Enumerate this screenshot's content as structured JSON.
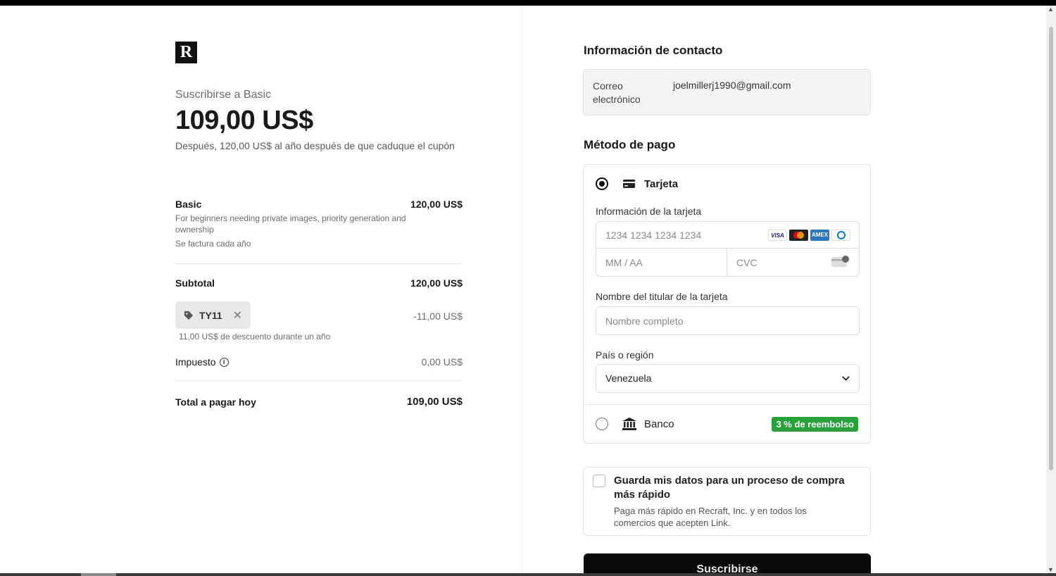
{
  "summary": {
    "logo_letter": "R",
    "subscribe_to": "Suscribirse a Basic",
    "price": "109,00 US$",
    "after_note": "Después, 120,00 US$ al año después de que caduque el cupón",
    "item": {
      "name": "Basic",
      "price": "120,00 US$",
      "description": "For beginners needing private images, priority generation and ownership",
      "billing": "Se factura cada año"
    },
    "subtotal_label": "Subtotal",
    "subtotal_value": "120,00 US$",
    "coupon_code": "TY11",
    "coupon_remove": "✕",
    "discount_value": "-11,00 US$",
    "discount_note": "11,00 US$ de descuento durante un año",
    "tax_label": "Impuesto",
    "tax_info": "i",
    "tax_value": "0,00 US$",
    "total_label": "Total a pagar hoy",
    "total_value": "109,00 US$"
  },
  "contact": {
    "title": "Información de contacto",
    "email_label": "Correo electrónico",
    "email_value": "joelmillerj1990@gmail.com"
  },
  "payment": {
    "title": "Método de pago",
    "card_option": "Tarjeta",
    "card_info_label": "Información de la tarjeta",
    "card_number_placeholder": "1234 1234 1234 1234",
    "expiry_placeholder": "MM / AA",
    "cvc_placeholder": "CVC",
    "brands": {
      "visa": "VISA",
      "amex": "AMEX"
    },
    "holder_label": "Nombre del titular de la tarjeta",
    "holder_placeholder": "Nombre completo",
    "country_label": "País o región",
    "country_value": "Venezuela",
    "bank_option": "Banco",
    "cashback_badge": "3 % de reembolso"
  },
  "save": {
    "title": "Guarda mis datos para un proceso de compra más rápido",
    "description": "Paga más rápido en Recraft, Inc. y en todos los comercios que acepten Link."
  },
  "subscribe_button": "Suscribirse",
  "colors": {
    "accent_green": "#27a23a",
    "button_black": "#0a0a0a"
  }
}
